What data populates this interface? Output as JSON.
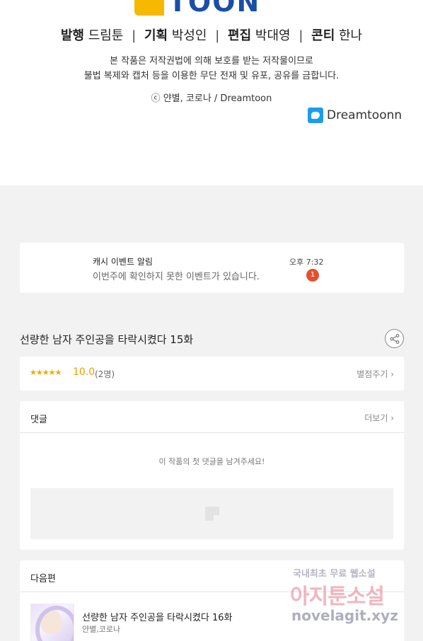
{
  "logo": {
    "text": "TOON"
  },
  "staff": {
    "publish_label": "발행",
    "publish_value": "드림툰",
    "plan_label": "기획",
    "plan_value": "박성인",
    "edit_label": "편집",
    "edit_value": "박대영",
    "conti_label": "콘티",
    "conti_value": "한나",
    "separator": "|"
  },
  "notice": {
    "line1": "본 작품은 저작권법에 의해 보호를 받는 저작물이므로",
    "line2": "불법 복제와 캡처 등을 이용한 무단 전재 및 유포, 공유를 금합니다."
  },
  "copyright": "ⓒ 얀별, 코로나 / Dreamtoon",
  "twitter": {
    "handle": "Dreamtoonn",
    "icon": "twitter-icon"
  },
  "notification": {
    "title": "캐시 이벤트 알림",
    "message": "이번주에 확인하지 못한 이벤트가 있습니다.",
    "time": "오후 7:32",
    "badge": "1"
  },
  "episode": {
    "title": "선량한 남자 주인공을 타락시켰다 15화"
  },
  "rating": {
    "stars": "★★★★★",
    "score": "10.0",
    "count": "(2명)",
    "link": "별점주기 ›"
  },
  "comments": {
    "title": "댓글",
    "more": "더보기 ›",
    "empty_text": "이 작품의 첫 댓글을 남겨주세요!"
  },
  "next": {
    "title": "다음편",
    "episode_title": "선량한 남자 주인공을 타락시켰다 16화",
    "author": "얀별,코로나"
  },
  "watermark": {
    "line1": "국내최초 무료 웹소설",
    "line2": "아지툰소설",
    "line3": "novelagit.xyz"
  },
  "colors": {
    "accent": "#e4502f",
    "brand": "#1a4ea8",
    "star": "#f2a800"
  }
}
